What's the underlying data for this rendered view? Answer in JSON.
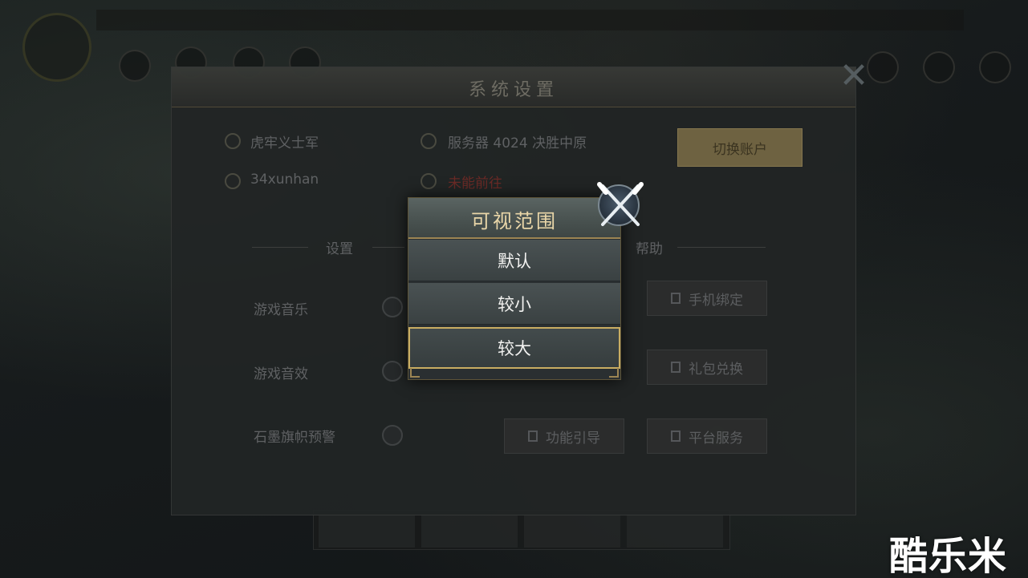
{
  "settings": {
    "title": "系统设置",
    "info": {
      "title_line": "虎牢义士军",
      "server": "服务器 4024 决胜中原",
      "account": "34xunhan",
      "status_red": "未能前往"
    },
    "switch_account_label": "切换账户",
    "section_left": "设置",
    "section_right": "帮助",
    "options": [
      {
        "label": "游戏音乐"
      },
      {
        "label": "游戏音效"
      },
      {
        "label": "石墨旗帜预警"
      }
    ],
    "buttons": {
      "phone_bind": "手机绑定",
      "gift_code": "礼包兑换",
      "feature_guide": "功能引导",
      "help_misc": "平台服务"
    }
  },
  "popup": {
    "title": "可视范围",
    "options": [
      "默认",
      "较小",
      "较大"
    ],
    "selected_index": 2
  },
  "watermark": "酷乐米",
  "colors": {
    "accent_gold": "#c9ad62",
    "title_text": "#e9d6a8",
    "option_text": "#f2f2f0"
  }
}
